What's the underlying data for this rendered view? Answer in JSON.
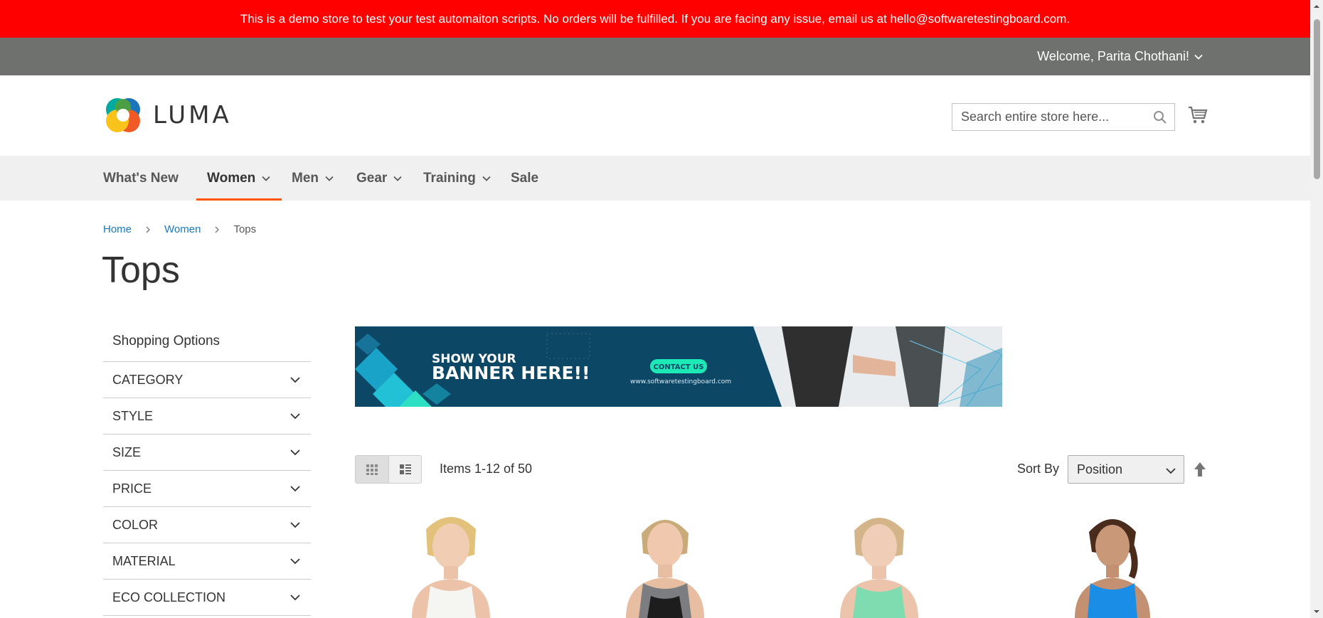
{
  "demo_notice": "This is a demo store to test your test automaiton scripts. No orders will be fulfilled. If you are facing any issue, email us at hello@softwaretestingboard.com.",
  "header": {
    "welcome": "Welcome, Parita Chothani!",
    "logo_text": "LUMA",
    "search_placeholder": "Search entire store here..."
  },
  "nav": [
    {
      "label": "What's New"
    },
    {
      "label": "Women"
    },
    {
      "label": "Men"
    },
    {
      "label": "Gear"
    },
    {
      "label": "Training"
    },
    {
      "label": "Sale"
    }
  ],
  "breadcrumb": {
    "home": "Home",
    "women": "Women",
    "current": "Tops"
  },
  "page_title": "Tops",
  "sidebar": {
    "title": "Shopping Options",
    "filters": [
      "CATEGORY",
      "STYLE",
      "SIZE",
      "PRICE",
      "COLOR",
      "MATERIAL",
      "ECO COLLECTION"
    ]
  },
  "banner": {
    "line1": "SHOW YOUR",
    "line2": "BANNER HERE!!",
    "cta": "CONTACT US",
    "url": "www.softwaretestingboard.com"
  },
  "toolbar": {
    "amount": "Items 1-12 of 50",
    "sort_label": "Sort By",
    "sort_value": "Position"
  },
  "colors": {
    "demo_bar": "#ff0000",
    "panel_header": "#6e716e",
    "nav_bg": "#f0f0f0",
    "nav_active_underline": "#ff5501",
    "link": "#1979c3"
  }
}
